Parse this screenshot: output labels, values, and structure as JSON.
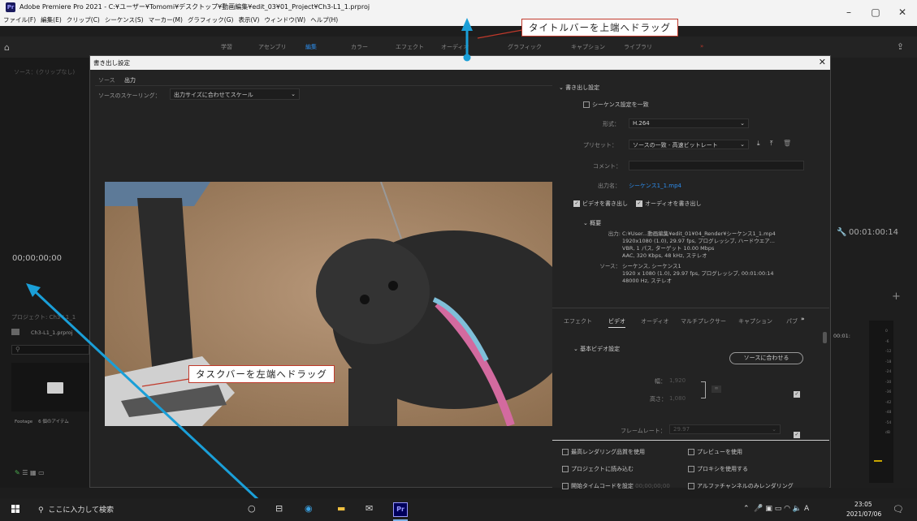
{
  "window": {
    "title": "Adobe Premiere Pro 2021 - C:¥ユーザー¥Tomomi¥デスクトップ¥動画編集¥edit_03¥01_Project¥Ch3-L1_1.prproj",
    "app_icon": "Pr",
    "controls": {
      "minimize": "–",
      "maximize": "▢",
      "close": "✕"
    }
  },
  "menu": [
    "ファイル(F)",
    "編集(E)",
    "クリップ(C)",
    "シーケンス(S)",
    "マーカー(M)",
    "グラフィック(G)",
    "表示(V)",
    "ウィンドウ(W)",
    "ヘルプ(H)"
  ],
  "workspace": {
    "tabs": [
      "学習",
      "アセンブリ",
      "編集",
      "カラー",
      "エフェクト",
      "オーディオ",
      "グラフィック",
      "キャプション",
      "ライブラリ",
      "»"
    ],
    "active_index": 2
  },
  "left_panel": {
    "source_label": "ソース：(クリップなし)",
    "timecode": "00;00;00;00",
    "project_title": "プロジェクト: Ch3-L1_1",
    "project_file": "Ch3-L1_1.prproj",
    "footage_label": "Footage",
    "footage_count": "6 個のアイテム"
  },
  "right_col": {
    "timecode": "00:01:00:14",
    "timeline_tc": "00:01:",
    "meter_labels": [
      "0",
      "-6",
      "-12",
      "-18",
      "-24",
      "-30",
      "-36",
      "-42",
      "-48",
      "-54",
      "dB"
    ]
  },
  "dialog": {
    "title": "書き出し設定",
    "close": "✕",
    "tabs": [
      "ソース",
      "出力"
    ],
    "scale_label": "ソースのスケーリング：",
    "scale_value": "出力サイズに合わせてスケール",
    "export_settings": {
      "header": "書き出し設定",
      "match_sequence": "シーケンス設定を一致",
      "format_label": "形式：",
      "format_value": "H.264",
      "preset_label": "プリセット：",
      "preset_value": "ソースの一致 - 高速ビットレート",
      "comment_label": "コメント：",
      "output_name_label": "出力名：",
      "output_name_value": "シーケンス1_1.mp4",
      "export_video": "ビデオを書き出し",
      "export_audio": "オーディオを書き出し",
      "summary_header": "概要",
      "output_label": "出力:",
      "output_lines": [
        "C:¥User...動画編集¥edit_01¥04_Render¥シーケンス1_1.mp4",
        "1920x1080 (1.0), 29.97 fps, プログレッシブ, ハードウエア...",
        "VBR, 1 パス, ターゲット 10.00 Mbps",
        "AAC, 320 Kbps, 48 kHz, ステレオ"
      ],
      "source_label": "ソース：",
      "source_lines": [
        "シーケンス, シーケンス1",
        "1920 x 1080 (1.0), 29.97 fps, プログレッシブ, 00:01:00:14",
        "48000 Hz, ステレオ"
      ]
    },
    "lower_tabs": [
      "エフェクト",
      "ビデオ",
      "オーディオ",
      "マルチプレクサー",
      "キャプション",
      "パブ",
      "»"
    ],
    "lower_active": 1,
    "video": {
      "header": "基本ビデオ設定",
      "match_button": "ソースに合わせる",
      "width_label": "幅：",
      "width_value": "1,920",
      "height_label": "高さ：",
      "height_value": "1,080",
      "framerate_label": "フレームレート：",
      "framerate_value": "29.97"
    },
    "bottom_options": [
      "最高レンダリング品質を使用",
      "プレビューを使用",
      "プロジェクトに読み込む",
      "プロキシを使用する",
      "開始タイムコードを設定",
      "アルファチャンネルのみレンダリング"
    ],
    "start_tc": "00;00;00;00"
  },
  "taskbar": {
    "search_placeholder": "ここに入力して検索",
    "ime": "A",
    "time": "23:05",
    "date": "2021/07/06"
  },
  "annotations": {
    "title_drag": "タイトルバーを上端へドラッグ",
    "taskbar_drag": "タスクバーを左端へドラッグ"
  },
  "colors": {
    "accent": "#2d8ceb",
    "arrow": "#1a9fd8",
    "callout_border": "#c0392b"
  }
}
